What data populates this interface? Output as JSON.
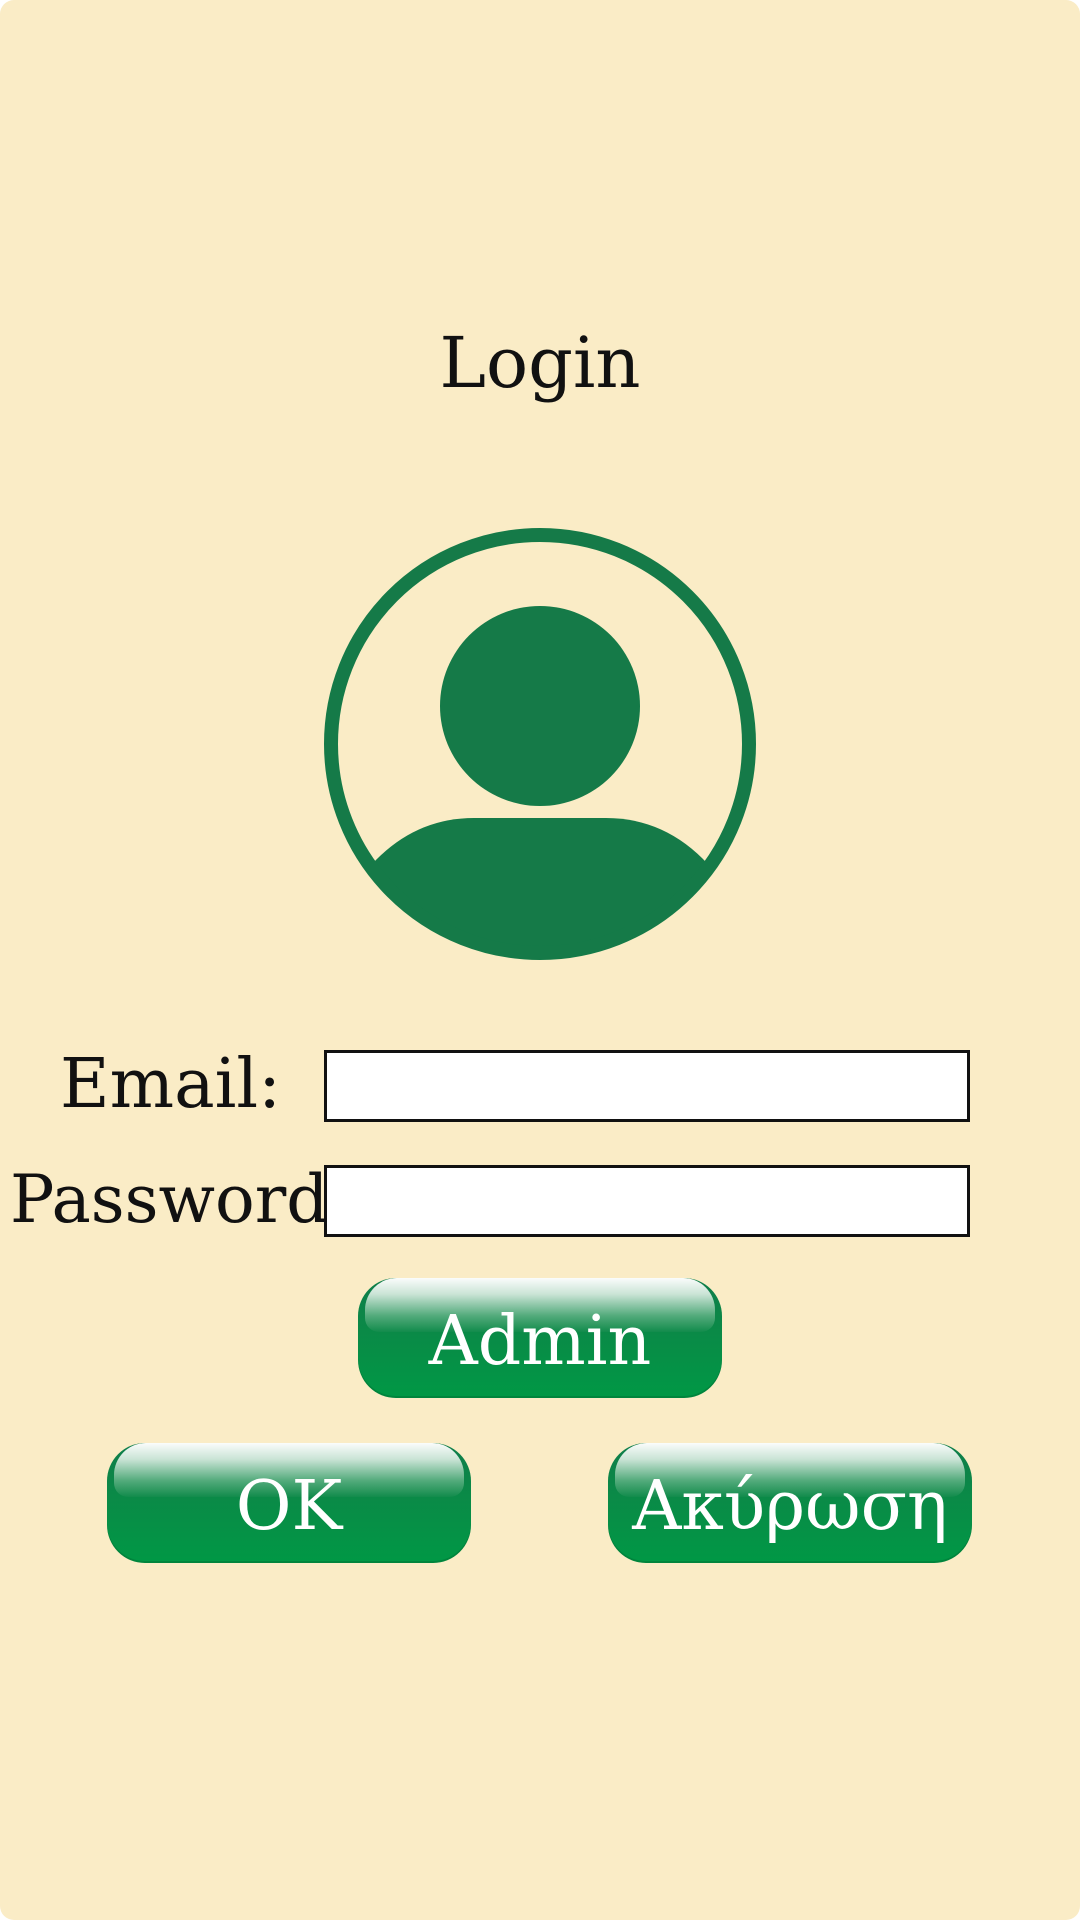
{
  "login": {
    "title": "Login",
    "avatar_icon": "user-circle-icon",
    "email_label": "Email:",
    "email_value": "",
    "password_label": "Password:",
    "password_value": "",
    "admin_button": "Admin",
    "ok_button": "OK",
    "cancel_button": "Ακύρωση"
  },
  "colors": {
    "background": "#faecc6",
    "accent": "#157a48",
    "button": "#009845"
  }
}
